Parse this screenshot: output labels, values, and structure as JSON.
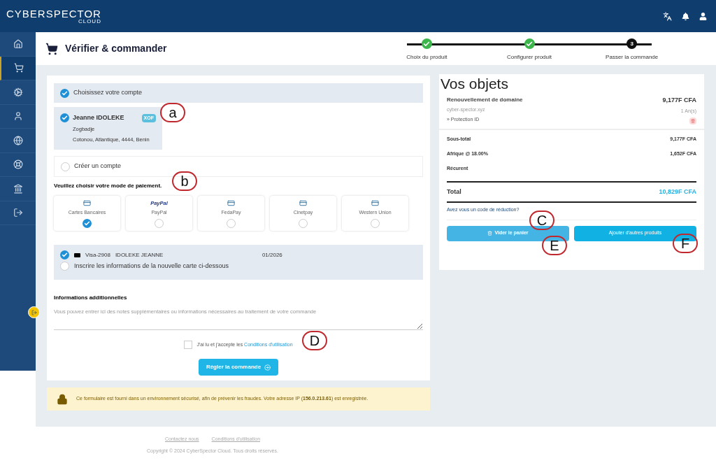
{
  "brand": {
    "name": "CYBERSPECTOR",
    "sub": "CLOUD"
  },
  "sidebar": {
    "items": [
      {
        "selected": false
      },
      {
        "selected": true
      },
      {
        "selected": false
      },
      {
        "selected": false
      },
      {
        "selected": false
      },
      {
        "selected": false
      },
      {
        "selected": false
      },
      {
        "selected": false
      }
    ]
  },
  "page": {
    "title": "Vérifier & commander"
  },
  "steps": [
    {
      "label": "Choix du produit",
      "kind": "done"
    },
    {
      "label": "Configurer produit",
      "kind": "done"
    },
    {
      "label": "Passer la commande",
      "kind": "current",
      "number": "3"
    }
  ],
  "account": {
    "heading": "Choisissez votre compte",
    "heading_checked": true,
    "accounts": [
      {
        "name": "Jeanne IDOLEKE",
        "currency": "XOF",
        "lines": [
          "Zogbadje",
          "Cotonou, Atlantique, 4444, Benin"
        ],
        "selected": true
      }
    ],
    "create": {
      "label": "Créer un compte",
      "selected": false
    }
  },
  "payment": {
    "heading": "Veuillez choisir votre mode de paiement.",
    "methods": [
      {
        "label": "Cartes Bancaires",
        "kind": "card",
        "selected": true
      },
      {
        "label": "PayPal",
        "kind": "paypal",
        "logo": "PayPal",
        "selected": false
      },
      {
        "label": "FedaPay",
        "kind": "card",
        "selected": false
      },
      {
        "label": "Cinetpay",
        "kind": "card",
        "selected": false
      },
      {
        "label": "Western Union",
        "kind": "card",
        "selected": false
      }
    ]
  },
  "cards": [
    {
      "kind": "saved",
      "label": "Visa-2908",
      "holder": "IDOLEKE JEANNE",
      "expiry": "01/2026",
      "selected": true
    },
    {
      "kind": "new",
      "label": "Inscrire les informations de la nouvelle carte ci-dessous",
      "selected": false
    }
  ],
  "notes": {
    "heading": "Informations additionnelles",
    "placeholder": "Vous pouvez entrer ici des notes supplémentaires ou informations nécessaires au traitement de votre commande"
  },
  "terms": {
    "text": "J'ai lu et j'accepte les",
    "link": "Conditions d'utilisation",
    "checked": false
  },
  "submit": "Régler la commande",
  "notice": "Ce formulaire est fourni dans un environnement sécurisé, afin de prévenir les fraudes. Votre adresse IP (**156.0.213.61**) est enregistrée.",
  "summary": {
    "title": "Vos objets",
    "items": [
      {
        "name": "Renouvellement de domaine",
        "domain": "cyber-spector.xyz",
        "addon": "» Protection ID",
        "price": "9,177F CFA",
        "period": "1 An(s)"
      }
    ],
    "lines": [
      {
        "label": "Sous-total",
        "value": "9,177F CFA"
      },
      {
        "label": "Afrique @ 18.00%",
        "value": "1,652F CFA"
      },
      {
        "label": "Récurent"
      }
    ],
    "total_label": "Total",
    "total": "10,829F CFA",
    "promo": "Avez vous un code de réduction?",
    "buttons": [
      {
        "label": "Vider le panier",
        "kind": "empty"
      },
      {
        "label": "Ajouter d'autres produits",
        "kind": "add"
      }
    ]
  },
  "footer": {
    "links": [
      "Contactez nous",
      "Conditions d'utilisation"
    ],
    "copyright": "Copyright © 2024 CyberSpector Cloud. Tous droits réservés."
  },
  "annotations": [
    {
      "label": "a"
    },
    {
      "label": "b"
    },
    {
      "label": "C"
    },
    {
      "label": "D"
    },
    {
      "label": "E"
    },
    {
      "label": "F"
    }
  ]
}
